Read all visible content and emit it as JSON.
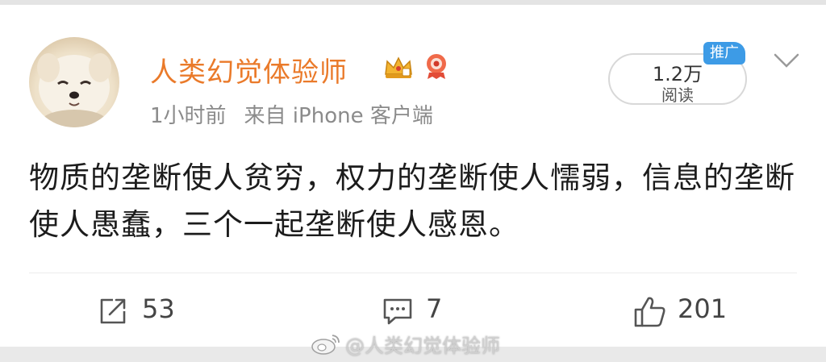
{
  "post": {
    "author": "人类幻觉体验师",
    "time": "1小时前",
    "source": "来自 iPhone 客户端",
    "read_count": "1.2万",
    "read_label": "阅读",
    "promo_tag": "推广",
    "text": "物质的垄断使人贫穷，权力的垄断使人懦弱，信息的垄断使人愚蠢，三个一起垄断使人感恩。"
  },
  "actions": {
    "repost_count": "53",
    "comment_count": "7",
    "like_count": "201"
  },
  "watermark": "@人类幻觉体验师",
  "icons": {
    "avatar": "dog-avatar",
    "badge1": "crown-badge-icon",
    "badge2": "red-badge-icon",
    "more": "chevron-down-icon",
    "repost": "repost-icon",
    "comment": "comment-icon",
    "like": "thumbs-up-icon"
  },
  "colors": {
    "author_name": "#ea7a2a",
    "promo_tag": "#3d9be6",
    "meta_text": "#8b8b8b"
  }
}
